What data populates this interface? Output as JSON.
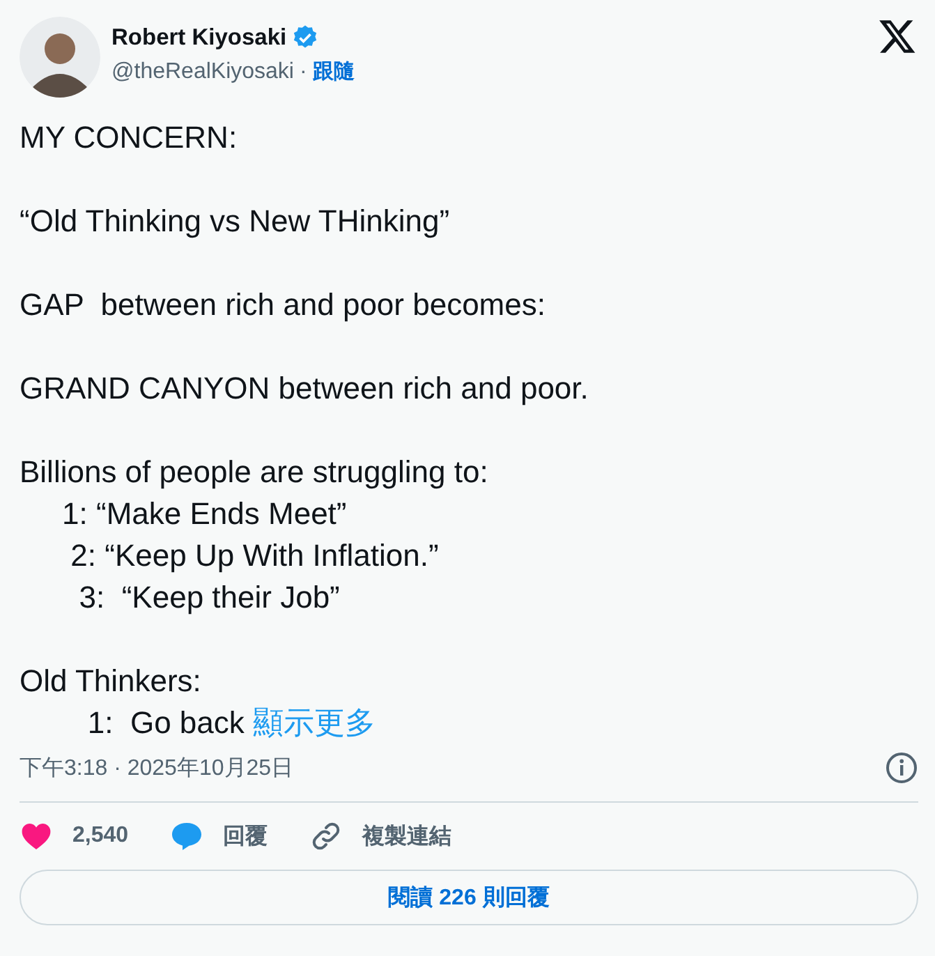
{
  "author": {
    "name": "Robert Kiyosaki",
    "verified": true,
    "handle": "@theRealKiyosaki",
    "separator": "·",
    "follow": "跟隨"
  },
  "body": {
    "paragraphs": [
      [
        "MY CONCERN:"
      ],
      [
        "“Old Thinking vs New THinking”"
      ],
      [
        "GAP  between rich and poor becomes:"
      ],
      [
        "GRAND CANYON between rich and poor."
      ],
      [
        "Billions of people are struggling to:",
        "     1: “Make Ends Meet”",
        "      2: “Keep Up With Inflation.”",
        "       3:  “Keep their Job”"
      ],
      [
        "Old Thinkers:",
        "        1:  Go back "
      ]
    ],
    "show_more": "顯示更多"
  },
  "timestamp": "下午3:18 · 2025年10月25日",
  "actions": [
    {
      "kind": "like",
      "label": "2,540"
    },
    {
      "kind": "reply",
      "label": "回覆"
    },
    {
      "kind": "copy",
      "label": "複製連結"
    }
  ],
  "read_replies": "閱讀 **226** 則回覆"
}
